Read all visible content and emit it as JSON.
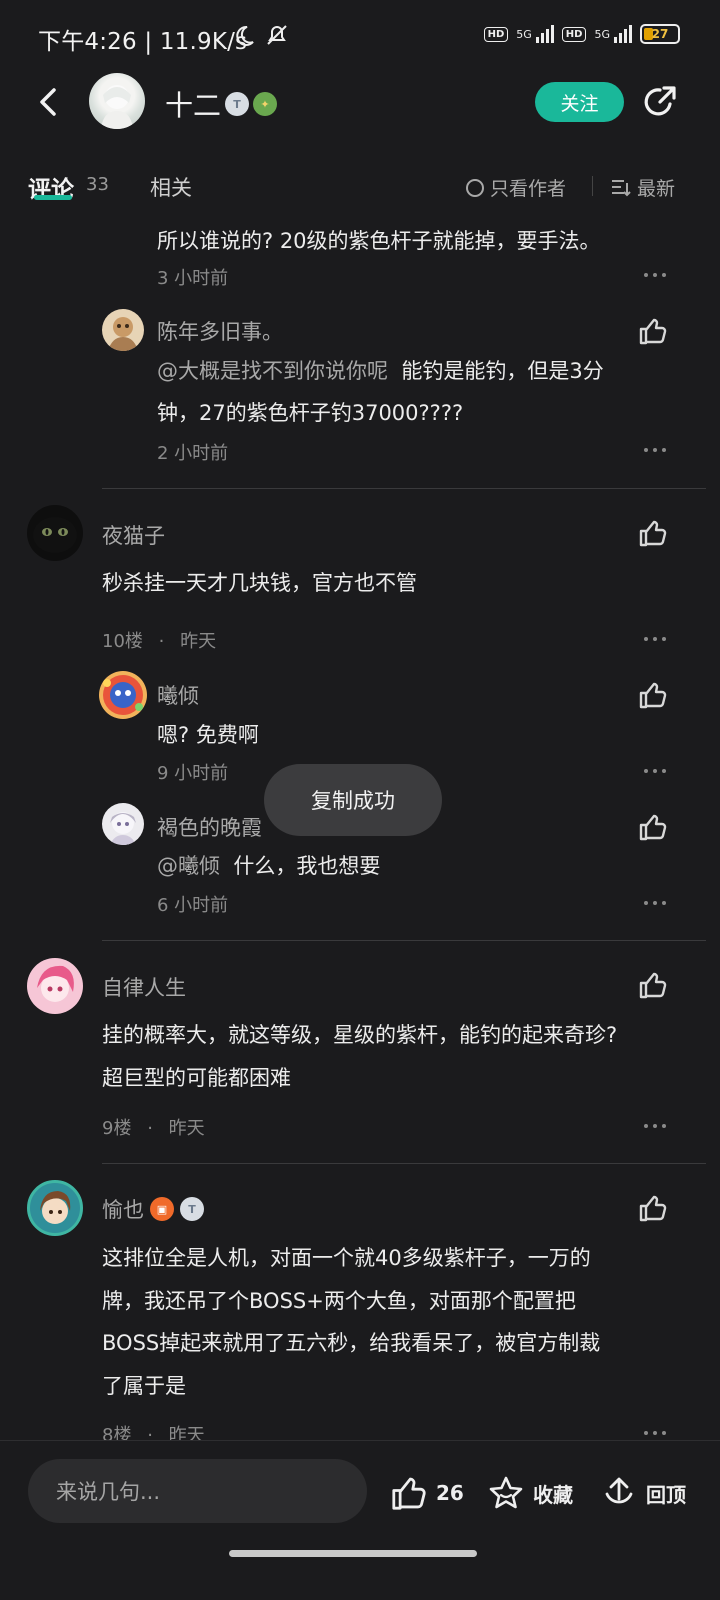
{
  "status_bar": {
    "time_speed": "下午4:26 | 11.9K/s",
    "hd1": "HD",
    "net1": "5G",
    "hd2": "HD",
    "net2": "5G",
    "battery": "27"
  },
  "header": {
    "name": "十二",
    "follow_label": "关注"
  },
  "tabs": {
    "comments_label": "评论",
    "comments_count": "33",
    "related_label": "相关",
    "author_only_label": "只看作者",
    "sort_label": "最新"
  },
  "comments": [
    {
      "text": "所以谁说的? 20级的紫色杆子就能掉，要手法。",
      "time": "3 小时前"
    },
    {
      "user": "陈年多旧事。",
      "mention": "@大概是找不到你说你呢",
      "text1": "能钓是能钓，但是3分",
      "text2": "钟，27的紫色杆子钓37000????",
      "time": "2 小时前"
    },
    {
      "user": "夜猫子",
      "text": "秒杀挂一天才几块钱，官方也不管",
      "floor": "10楼",
      "time": "昨天"
    },
    {
      "user": "曦倾",
      "text": "嗯? 免费啊",
      "time": "9 小时前"
    },
    {
      "user": "褐色的晚霞",
      "mention": "@曦倾",
      "text": "什么，我也想要",
      "time": "6 小时前"
    },
    {
      "user": "自律人生",
      "text1": "挂的概率大，就这等级，星级的紫杆，能钓的起来奇珍?",
      "text2": "超巨型的可能都困难",
      "floor": "9楼",
      "time": "昨天"
    },
    {
      "user": "愉也",
      "text1": "这排位全是人机，对面一个就40多级紫杆子，一万的",
      "text2": "牌，我还吊了个BOSS+两个大鱼，对面那个配置把",
      "text3": "BOSS掉起来就用了五六秒，给我看呆了，被官方制裁",
      "text4": "了属于是",
      "floor": "8楼",
      "time": "昨天"
    }
  ],
  "separator_dot": "·",
  "toast": "复制成功",
  "bottom": {
    "input_placeholder": "来说几句...",
    "like_count": "26",
    "favorite_label": "收藏",
    "top_label": "回顶"
  },
  "colors": {
    "accent": "#1ab89a",
    "background": "#1b1b1d"
  }
}
